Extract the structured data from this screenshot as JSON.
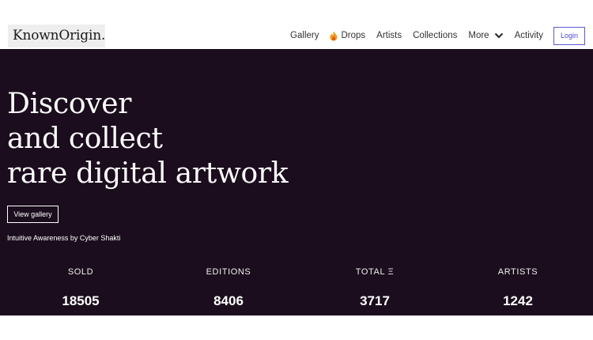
{
  "brand": {
    "logo_text": "KnownOrigin."
  },
  "nav": {
    "items": [
      "Gallery",
      "Drops",
      "Artists",
      "Collections",
      "More",
      "Activity"
    ],
    "login_label": "Login",
    "drops_icon": "flame-icon",
    "more_icon": "chevron-down-icon"
  },
  "hero": {
    "headline": [
      "Discover",
      "and collect",
      "rare digital artwork"
    ],
    "cta_label": "View gallery",
    "caption": "Intuitive Awareness by Cyber Shakti"
  },
  "stats": [
    {
      "label": "SOLD",
      "value": "18505"
    },
    {
      "label": "EDITIONS",
      "value": "8406"
    },
    {
      "label": "TOTAL Ξ",
      "value": "3717"
    },
    {
      "label": "ARTISTS",
      "value": "1242"
    }
  ],
  "colors": {
    "hero_background": "#1b0d1d",
    "login_accent": "#5b5bd6",
    "logo_background": "#eeeeee"
  }
}
